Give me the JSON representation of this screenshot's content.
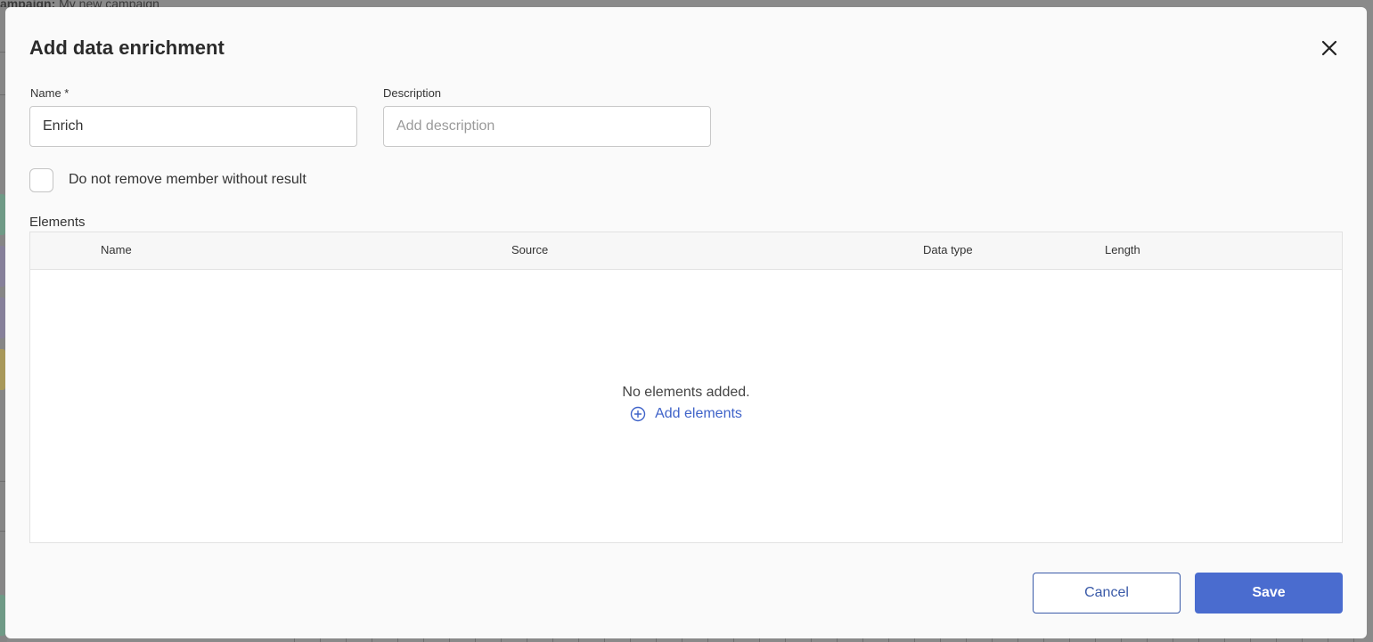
{
  "background": {
    "campaign_label": "ampaign:",
    "campaign_value": "My new campaign"
  },
  "dialog": {
    "title": "Add data enrichment",
    "close_icon": "close-icon"
  },
  "form": {
    "name_label": "Name *",
    "name_value": "Enrich",
    "description_label": "Description",
    "description_placeholder": "Add description",
    "checkbox_label": "Do not remove member without result",
    "checkbox_checked": false
  },
  "elements": {
    "section_label": "Elements",
    "columns": [
      "Name",
      "Source",
      "Data type",
      "Length"
    ],
    "rows": [],
    "empty_text": "No elements added.",
    "add_link": "Add elements",
    "add_icon": "plus-circle-icon"
  },
  "footer": {
    "cancel_label": "Cancel",
    "save_label": "Save"
  },
  "colors": {
    "accent": "#4a6ccf",
    "link": "#3f63c9",
    "cancel_border": "#3a5aa8",
    "backdrop": "#8a8a8a"
  }
}
